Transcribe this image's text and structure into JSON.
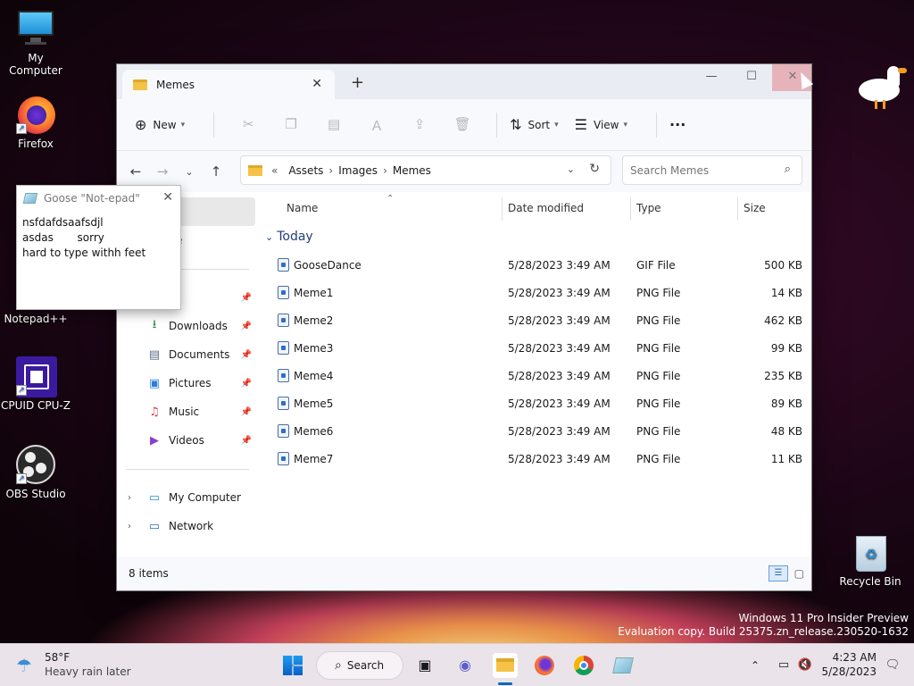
{
  "desktop": {
    "icons": [
      {
        "label": "My Computer"
      },
      {
        "label": "Firefox"
      },
      {
        "label": "Notepad++"
      },
      {
        "label": "CPUID CPU-Z"
      },
      {
        "label": "OBS Studio"
      },
      {
        "label": "Recycle Bin"
      }
    ],
    "watermark_line1": "Windows 11 Pro Insider Preview",
    "watermark_line2": "Evaluation copy. Build 25375.zn_release.230520-1632"
  },
  "explorer": {
    "tab_title": "Memes",
    "toolbar": {
      "new_label": "New",
      "sort_label": "Sort",
      "view_label": "View",
      "more_label": "···"
    },
    "breadcrumb": {
      "overflow": "«",
      "items": [
        "Assets",
        "Images",
        "Memes"
      ]
    },
    "search": {
      "placeholder": "Search Memes"
    },
    "sidebar": {
      "items": [
        {
          "label": "me"
        },
        {
          "label": "eDrive"
        },
        {
          "label": "ktop"
        },
        {
          "label": "Downloads"
        },
        {
          "label": "Documents"
        },
        {
          "label": "Pictures"
        },
        {
          "label": "Music"
        },
        {
          "label": "Videos"
        },
        {
          "label": "My Computer"
        },
        {
          "label": "Network"
        }
      ]
    },
    "columns": {
      "name": "Name",
      "date": "Date modified",
      "type": "Type",
      "size": "Size"
    },
    "group_label": "Today",
    "files": [
      {
        "name": "GooseDance",
        "date": "5/28/2023 3:49 AM",
        "type": "GIF File",
        "size": "500 KB"
      },
      {
        "name": "Meme1",
        "date": "5/28/2023 3:49 AM",
        "type": "PNG File",
        "size": "14 KB"
      },
      {
        "name": "Meme2",
        "date": "5/28/2023 3:49 AM",
        "type": "PNG File",
        "size": "462 KB"
      },
      {
        "name": "Meme3",
        "date": "5/28/2023 3:49 AM",
        "type": "PNG File",
        "size": "99 KB"
      },
      {
        "name": "Meme4",
        "date": "5/28/2023 3:49 AM",
        "type": "PNG File",
        "size": "235 KB"
      },
      {
        "name": "Meme5",
        "date": "5/28/2023 3:49 AM",
        "type": "PNG File",
        "size": "89 KB"
      },
      {
        "name": "Meme6",
        "date": "5/28/2023 3:49 AM",
        "type": "PNG File",
        "size": "48 KB"
      },
      {
        "name": "Meme7",
        "date": "5/28/2023 3:49 AM",
        "type": "PNG File",
        "size": "11 KB"
      }
    ],
    "status_count": "8 items"
  },
  "notepad": {
    "title": "Goose \"Not-epad\"",
    "text": "nsfdafdsaafsdjl\nasdas       sorry\nhard to type withh feet"
  },
  "taskbar": {
    "weather_temp": "58°F",
    "weather_desc": "Heavy rain later",
    "search_label": "Search",
    "time": "4:23 AM",
    "date": "5/28/2023"
  },
  "colors": {
    "accent": "#0067c0",
    "close_hover": "#e5b3b9"
  }
}
